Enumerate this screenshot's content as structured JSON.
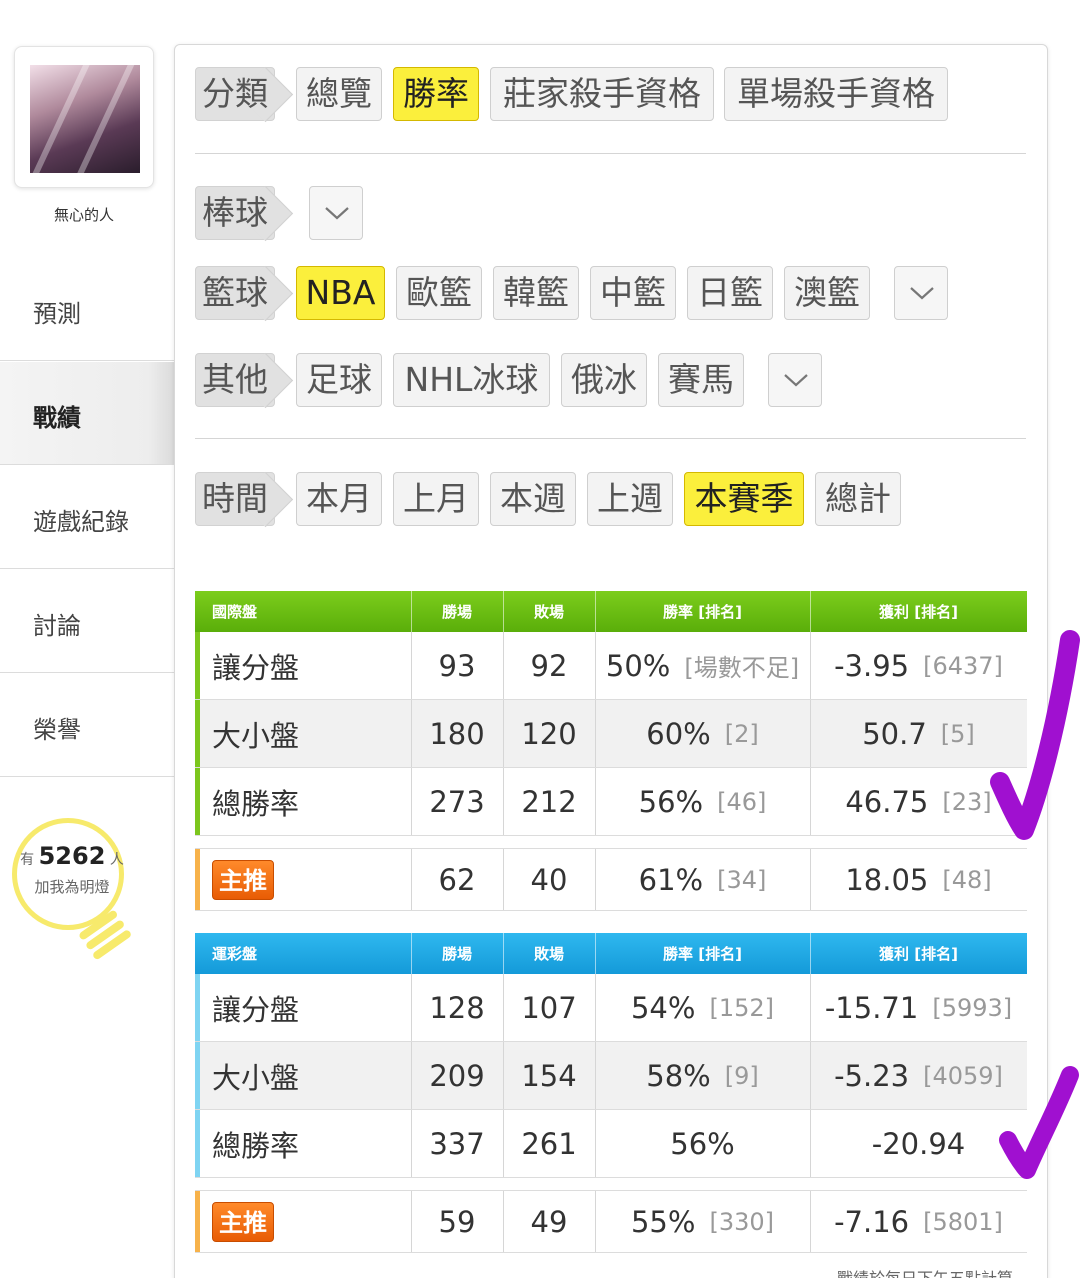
{
  "user": {
    "name": "無心的人"
  },
  "sidebar": {
    "items": [
      {
        "label": "預測",
        "active": false
      },
      {
        "label": "戰績",
        "active": true
      },
      {
        "label": "遊戲紀錄",
        "active": false
      },
      {
        "label": "討論",
        "active": false
      },
      {
        "label": "榮譽",
        "active": false
      }
    ]
  },
  "light": {
    "prefix": "有",
    "count": "5262",
    "unit": "人",
    "cta": "加我為明燈"
  },
  "filters": {
    "category": {
      "label": "分類",
      "options": [
        "總覽",
        "勝率",
        "莊家殺手資格",
        "單場殺手資格"
      ],
      "selected": "勝率"
    },
    "baseball": {
      "label": "棒球"
    },
    "basketball": {
      "label": "籃球",
      "options": [
        "NBA",
        "歐籃",
        "韓籃",
        "中籃",
        "日籃",
        "澳籃"
      ],
      "selected": "NBA"
    },
    "other": {
      "label": "其他",
      "options": [
        "足球",
        "NHL冰球",
        "俄冰",
        "賽馬"
      ]
    },
    "time": {
      "label": "時間",
      "options": [
        "本月",
        "上月",
        "本週",
        "上週",
        "本賽季",
        "總計"
      ],
      "selected": "本賽季"
    }
  },
  "tables": [
    {
      "title": "國際盤",
      "columns": [
        "勝場",
        "敗場",
        "勝率 [排名]",
        "獲利 [排名]"
      ],
      "rows": [
        {
          "name": "讓分盤",
          "wins": "93",
          "losses": "92",
          "rate": "50%",
          "rate_rank": "[場數不足]",
          "profit": "-3.95",
          "profit_rank": "[6437]"
        },
        {
          "name": "大小盤",
          "wins": "180",
          "losses": "120",
          "rate": "60%",
          "rate_rank": "[2]",
          "profit": "50.7",
          "profit_rank": "[5]"
        },
        {
          "name": "總勝率",
          "wins": "273",
          "losses": "212",
          "rate": "56%",
          "rate_rank": "[46]",
          "profit": "46.75",
          "profit_rank": "[23]"
        }
      ],
      "featured": {
        "badge": "主推",
        "wins": "62",
        "losses": "40",
        "rate": "61%",
        "rate_rank": "[34]",
        "profit": "18.05",
        "profit_rank": "[48]"
      }
    },
    {
      "title": "運彩盤",
      "columns": [
        "勝場",
        "敗場",
        "勝率 [排名]",
        "獲利 [排名]"
      ],
      "rows": [
        {
          "name": "讓分盤",
          "wins": "128",
          "losses": "107",
          "rate": "54%",
          "rate_rank": "[152]",
          "profit": "-15.71",
          "profit_rank": "[5993]"
        },
        {
          "name": "大小盤",
          "wins": "209",
          "losses": "154",
          "rate": "58%",
          "rate_rank": "[9]",
          "profit": "-5.23",
          "profit_rank": "[4059]"
        },
        {
          "name": "總勝率",
          "wins": "337",
          "losses": "261",
          "rate": "56%",
          "rate_rank": "",
          "profit": "-20.94",
          "profit_rank": ""
        }
      ],
      "featured": {
        "badge": "主推",
        "wins": "59",
        "losses": "49",
        "rate": "55%",
        "rate_rank": "[330]",
        "profit": "-7.16",
        "profit_rank": "[5801]"
      }
    }
  ],
  "footnote": "戰績於每日下午五點計算",
  "colors": {
    "selected_chip": "#fbef3c",
    "intl_header": "#6cbf12",
    "lottery_header": "#1fa8e4",
    "badge": "#f07214",
    "annotation": "#a010d0"
  }
}
